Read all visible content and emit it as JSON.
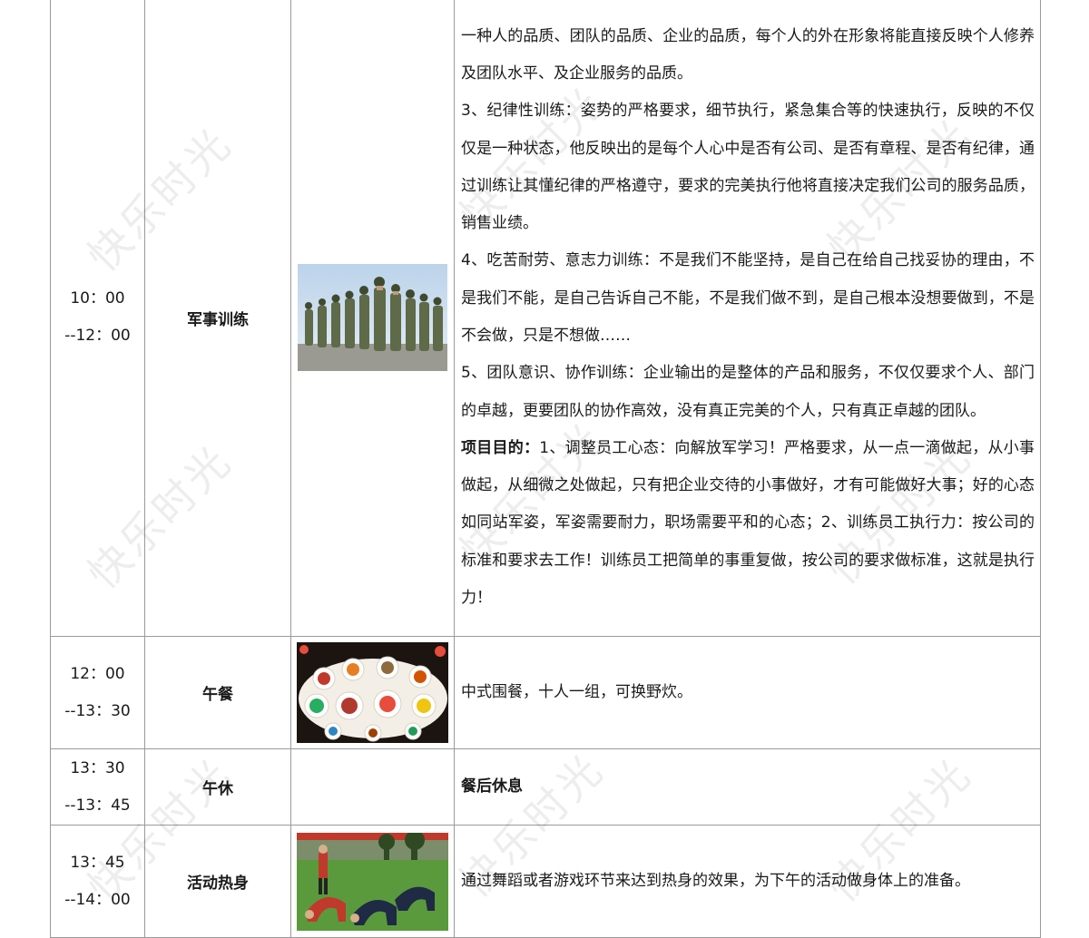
{
  "watermark_text": "快乐时光",
  "rows": [
    {
      "time_start": "10：00",
      "time_end": "--12：00",
      "activity": "军事训练",
      "image_icon": "military-drill-photo",
      "paragraphs": [
        "一种人的品质、团队的品质、企业的品质，每个人的外在形象将能直接反映个人修养及团队水平、及企业服务的品质。",
        "3、纪律性训练：姿势的严格要求，细节执行，紧急集合等的快速执行，反映的不仅仅是一种状态，他反映出的是每个人心中是否有公司、是否有章程、是否有纪律，通过训练让其懂纪律的严格遵守，要求的完美执行他将直接决定我们公司的服务品质，销售业绩。",
        "4、吃苦耐劳、意志力训练：不是我们不能坚持，是自己在给自己找妥协的理由，不是我们不能，是自己告诉自己不能，不是我们做不到，是自己根本没想要做到，不是不会做，只是不想做……",
        "5、团队意识、协作训练：企业输出的是整体的产品和服务，不仅仅要求个人、部门的卓越，更要团队的协作高效，没有真正完美的个人，只有真正卓越的团队。"
      ],
      "purpose_label": "项目目的：",
      "purpose_text": "1、调整员工心态：向解放军学习！严格要求，从一点一滴做起，从小事做起，从细微之处做起，只有把企业交待的小事做好，才有可能做好大事；好的心态如同站军姿，军姿需要耐力，职场需要平和的心态；2、训练员工执行力：按公司的标准和要求去工作！训练员工把简单的事重复做，按公司的要求做标准，这就是执行力！"
    },
    {
      "time_start": "12：00",
      "time_end": "--13：30",
      "activity": "午餐",
      "image_icon": "banquet-food-photo",
      "description": "中式围餐，十人一组，可换野炊。"
    },
    {
      "time_start": "13：30",
      "time_end": "--13：45",
      "activity": "午休",
      "description": "餐后休息"
    },
    {
      "time_start": "13：45",
      "time_end": "--14：00",
      "activity": "活动热身",
      "image_icon": "warmup-exercise-photo",
      "description": "通过舞蹈或者游戏环节来达到热身的效果，为下午的活动做身体上的准备。"
    }
  ]
}
